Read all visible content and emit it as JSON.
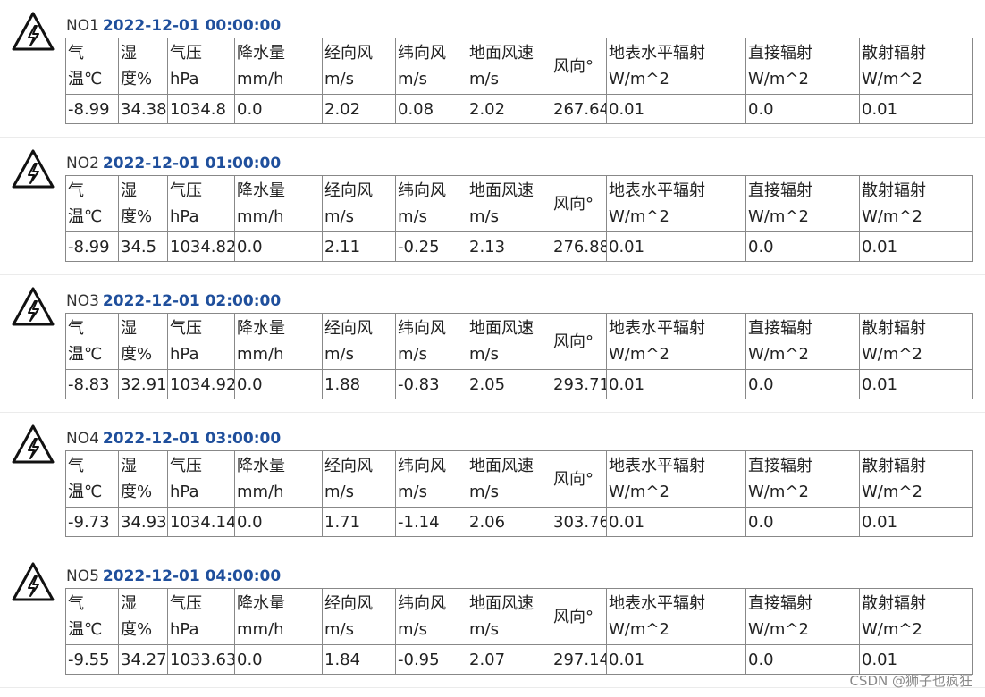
{
  "headers": [
    {
      "name": "气",
      "unit": "温℃"
    },
    {
      "name": "湿",
      "unit": "度%"
    },
    {
      "name": "气压",
      "unit": "hPa"
    },
    {
      "name": "降水量",
      "unit": "mm/h"
    },
    {
      "name": "经向风",
      "unit": "m/s"
    },
    {
      "name": "纬向风",
      "unit": "m/s"
    },
    {
      "name": "地面风速",
      "unit": "m/s"
    },
    {
      "name": "风向°",
      "unit": ""
    },
    {
      "name": "地表水平辐射",
      "unit": "W/m^2"
    },
    {
      "name": "直接辐射",
      "unit": "W/m^2"
    },
    {
      "name": "散射辐射",
      "unit": "W/m^2"
    }
  ],
  "records": [
    {
      "no": "NO1",
      "time": "2022-12-01 00:00:00",
      "values": [
        "-8.99",
        "34.38",
        "1034.8",
        "0.0",
        "2.02",
        "0.08",
        "2.02",
        "267.64",
        "0.01",
        "0.0",
        "0.01"
      ]
    },
    {
      "no": "NO2",
      "time": "2022-12-01 01:00:00",
      "values": [
        "-8.99",
        "34.5",
        "1034.82",
        "0.0",
        "2.11",
        "-0.25",
        "2.13",
        "276.88",
        "0.01",
        "0.0",
        "0.01"
      ]
    },
    {
      "no": "NO3",
      "time": "2022-12-01 02:00:00",
      "values": [
        "-8.83",
        "32.91",
        "1034.92",
        "0.0",
        "1.88",
        "-0.83",
        "2.05",
        "293.71",
        "0.01",
        "0.0",
        "0.01"
      ]
    },
    {
      "no": "NO4",
      "time": "2022-12-01 03:00:00",
      "values": [
        "-9.73",
        "34.93",
        "1034.14",
        "0.0",
        "1.71",
        "-1.14",
        "2.06",
        "303.76",
        "0.01",
        "0.0",
        "0.01"
      ]
    },
    {
      "no": "NO5",
      "time": "2022-12-01 04:00:00",
      "values": [
        "-9.55",
        "34.27",
        "1033.63",
        "0.0",
        "1.84",
        "-0.95",
        "2.07",
        "297.14",
        "0.01",
        "0.0",
        "0.01"
      ]
    }
  ],
  "icon": "high-voltage-warning-icon",
  "watermark": "CSDN @狮子也疯狂"
}
